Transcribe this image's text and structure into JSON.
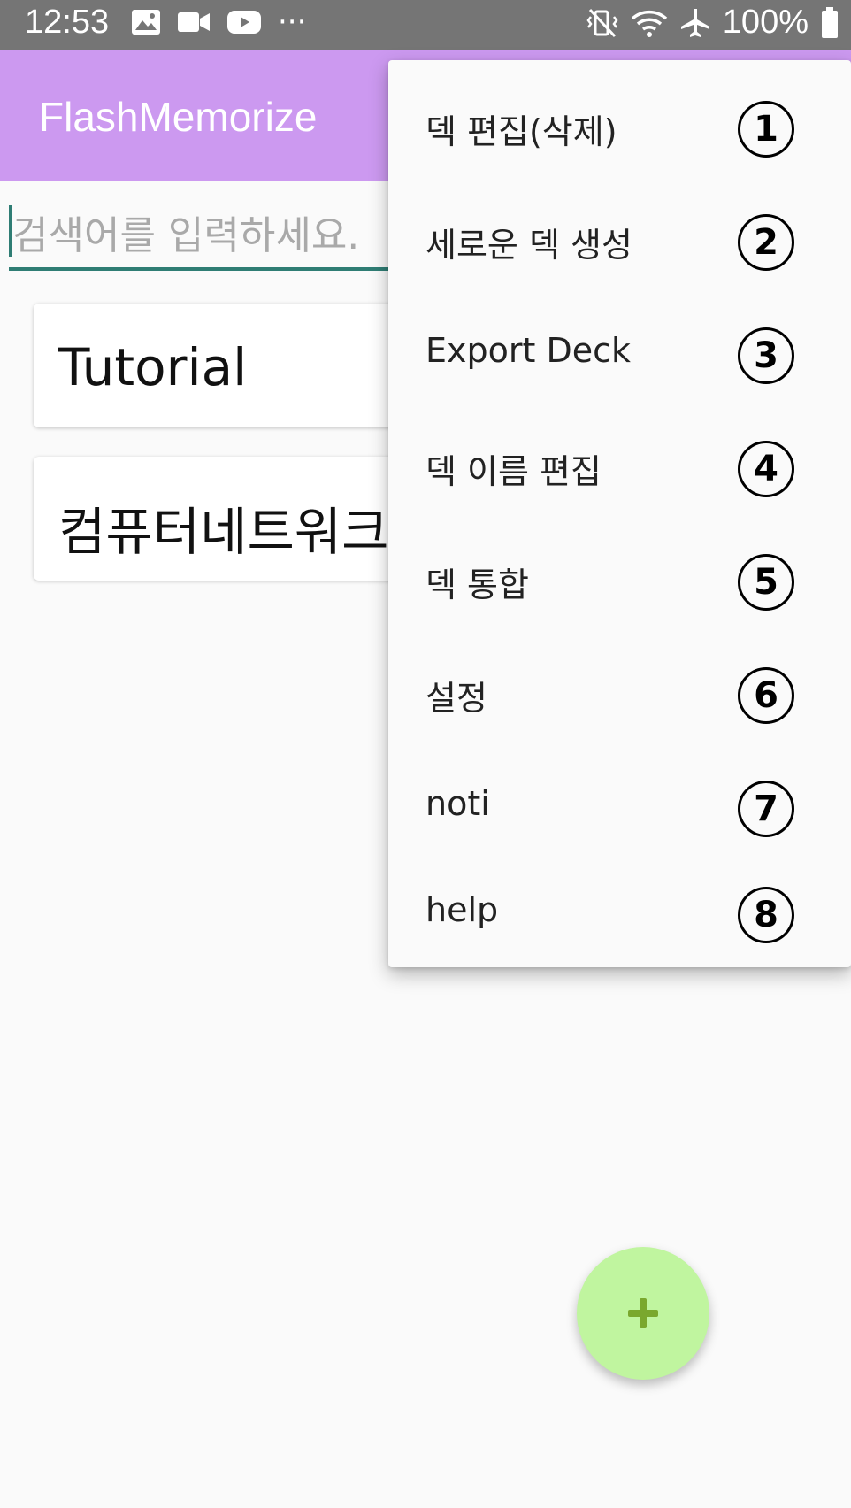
{
  "status_bar": {
    "time": "12:53",
    "battery": "100%",
    "overflow": "···",
    "left_icons": [
      "image-icon",
      "video-camera-icon",
      "youtube-icon",
      "more-dots-icon"
    ],
    "right_icons": [
      "vibrate-icon",
      "wifi-icon",
      "airplane-icon",
      "battery-icon"
    ]
  },
  "app_bar": {
    "title": "FlashMemorize"
  },
  "search": {
    "placeholder": "검색어를 입력하세요.",
    "value": ""
  },
  "decks": [
    {
      "name": "Tutorial"
    },
    {
      "name": "컴퓨터네트워크"
    }
  ],
  "menu": {
    "items": [
      {
        "label": "덱 편집(삭제)",
        "badge": "1"
      },
      {
        "label": "세로운 덱 생성",
        "badge": "2"
      },
      {
        "label": "Export Deck",
        "badge": "3"
      },
      {
        "label": "덱 이름 편집",
        "badge": "4"
      },
      {
        "label": "덱 통합",
        "badge": "5"
      },
      {
        "label": "설정",
        "badge": "6"
      },
      {
        "label": "noti",
        "badge": "7"
      },
      {
        "label": "help",
        "badge": "8"
      }
    ]
  },
  "fab": {
    "icon": "plus-icon"
  },
  "colors": {
    "app_bar": "#cc99f0",
    "status_bar": "#757575",
    "fab": "#c0f59f",
    "fab_icon": "#7aa82e",
    "search_accent": "#2f7d74"
  }
}
